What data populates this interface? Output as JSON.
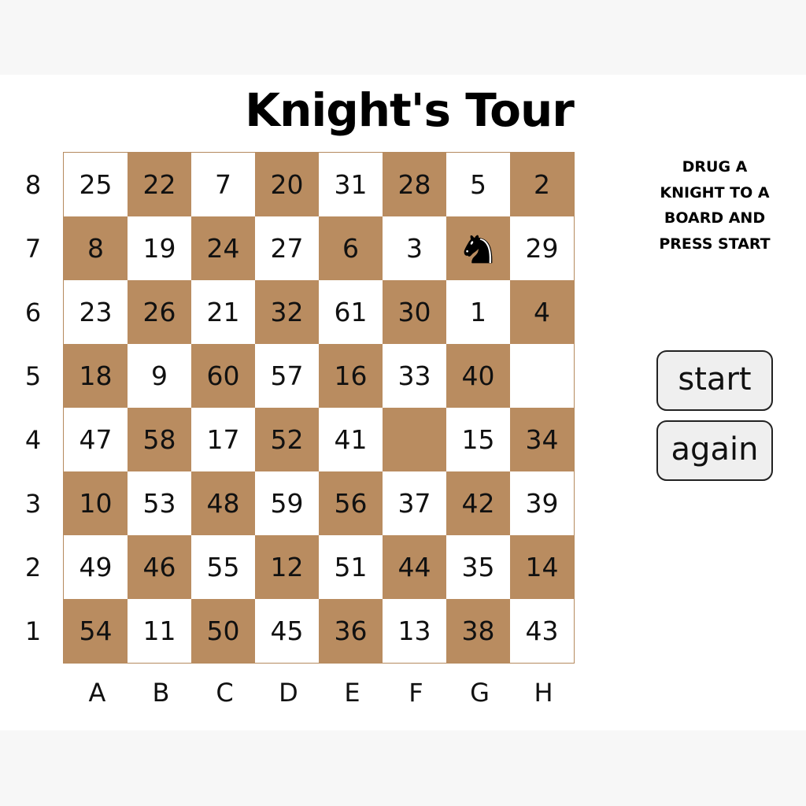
{
  "title": "Knight's Tour",
  "instructions": "DRUG A KNIGHT TO A BOARD AND PRESS START",
  "buttons": {
    "start": "start",
    "again": "again"
  },
  "ranks": [
    "8",
    "7",
    "6",
    "5",
    "4",
    "3",
    "2",
    "1"
  ],
  "files": [
    "A",
    "B",
    "C",
    "D",
    "E",
    "F",
    "G",
    "H"
  ],
  "colors": {
    "dark_square": "#b98c60",
    "light_square": "#ffffff",
    "knight": "#000000"
  },
  "board": [
    [
      "25",
      "22",
      "7",
      "20",
      "31",
      "28",
      "5",
      "2"
    ],
    [
      "8",
      "19",
      "24",
      "27",
      "6",
      "3",
      "knight",
      "29"
    ],
    [
      "23",
      "26",
      "21",
      "32",
      "61",
      "30",
      "1",
      "4"
    ],
    [
      "18",
      "9",
      "60",
      "57",
      "16",
      "33",
      "40",
      ""
    ],
    [
      "47",
      "58",
      "17",
      "52",
      "41",
      "",
      "15",
      "34"
    ],
    [
      "10",
      "53",
      "48",
      "59",
      "56",
      "37",
      "42",
      "39"
    ],
    [
      "49",
      "46",
      "55",
      "12",
      "51",
      "44",
      "35",
      "14"
    ],
    [
      "54",
      "11",
      "50",
      "45",
      "36",
      "13",
      "38",
      "43"
    ]
  ]
}
